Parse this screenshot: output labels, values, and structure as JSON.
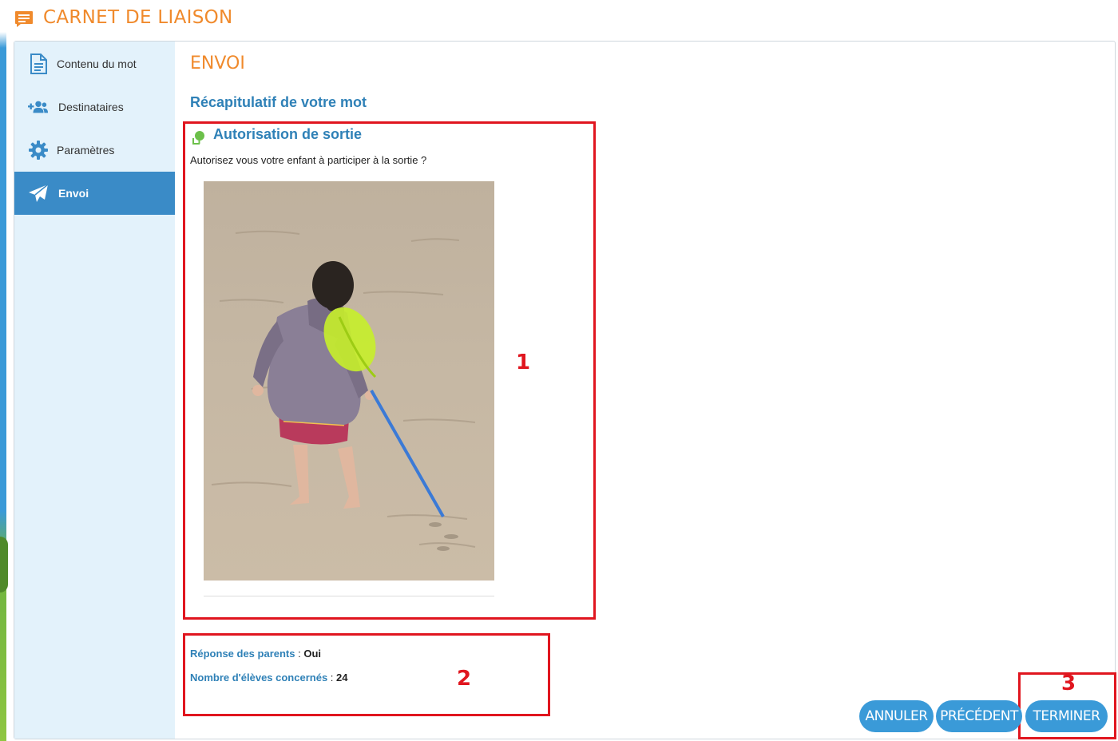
{
  "app": {
    "title": "CARNET DE LIAISON",
    "accent_color": "#f08a2c",
    "primary_color": "#3a8bc7"
  },
  "sidebar": {
    "items": [
      {
        "label": "Contenu du mot",
        "icon": "document-icon",
        "active": false
      },
      {
        "label": "Destinataires",
        "icon": "users-add-icon",
        "active": false
      },
      {
        "label": "Paramètres",
        "icon": "gear-icon",
        "active": false
      },
      {
        "label": "Envoi",
        "icon": "paper-plane-icon",
        "active": true
      }
    ]
  },
  "main": {
    "section_title": "ENVOI",
    "summary_title": "Récapitulatif de votre mot",
    "word": {
      "title": "Autorisation de sortie",
      "icon": "tree-icon",
      "question": "Autorisez vous votre enfant à participer à la sortie ?",
      "image": "photo of a child with a butterfly net on a sandy beach"
    },
    "details": {
      "parents_response_label": "Réponse des parents",
      "parents_response_value": "Oui",
      "students_count_label": "Nombre d'élèves concernés",
      "students_count_value": "24",
      "separator": ":"
    }
  },
  "annotations": [
    "1",
    "2",
    "3"
  ],
  "buttons": {
    "cancel": "ANNULER",
    "previous": "PRÉCÉDENT",
    "finish": "TERMINER"
  }
}
